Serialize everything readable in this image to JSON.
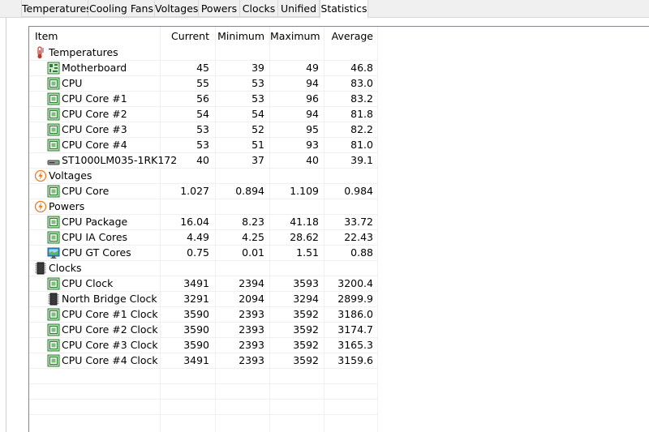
{
  "tabs": [
    {
      "label": "Temperatures",
      "active": false
    },
    {
      "label": "Cooling Fans",
      "active": false
    },
    {
      "label": "Voltages",
      "active": false
    },
    {
      "label": "Powers",
      "active": false
    },
    {
      "label": "Clocks",
      "active": false
    },
    {
      "label": "Unified",
      "active": false
    },
    {
      "label": "Statistics",
      "active": true
    }
  ],
  "columns": {
    "item": "Item",
    "current": "Current",
    "minimum": "Minimum",
    "maximum": "Maximum",
    "average": "Average"
  },
  "rows": [
    {
      "group": true,
      "icon": "thermometer-icon",
      "label": "Temperatures"
    },
    {
      "icon": "motherboard-icon",
      "label": "Motherboard",
      "current": "45",
      "minimum": "39",
      "maximum": "49",
      "average": "46.8"
    },
    {
      "icon": "cpu-chip-icon",
      "label": "CPU",
      "current": "55",
      "minimum": "53",
      "maximum": "94",
      "average": "83.0"
    },
    {
      "icon": "cpu-chip-icon",
      "label": "CPU Core #1",
      "current": "56",
      "minimum": "53",
      "maximum": "96",
      "average": "83.2"
    },
    {
      "icon": "cpu-chip-icon",
      "label": "CPU Core #2",
      "current": "54",
      "minimum": "54",
      "maximum": "94",
      "average": "81.8"
    },
    {
      "icon": "cpu-chip-icon",
      "label": "CPU Core #3",
      "current": "53",
      "minimum": "52",
      "maximum": "95",
      "average": "82.2"
    },
    {
      "icon": "cpu-chip-icon",
      "label": "CPU Core #4",
      "current": "53",
      "minimum": "51",
      "maximum": "93",
      "average": "81.0"
    },
    {
      "icon": "hard-drive-icon",
      "label": "ST1000LM035-1RK172",
      "current": "40",
      "minimum": "37",
      "maximum": "40",
      "average": "39.1"
    },
    {
      "group": true,
      "icon": "lightning-icon",
      "label": "Voltages"
    },
    {
      "icon": "cpu-chip-icon",
      "label": "CPU Core",
      "current": "1.027",
      "minimum": "0.894",
      "maximum": "1.109",
      "average": "0.984"
    },
    {
      "group": true,
      "icon": "lightning-icon",
      "label": "Powers"
    },
    {
      "icon": "cpu-chip-icon",
      "label": "CPU Package",
      "current": "16.04",
      "minimum": "8.23",
      "maximum": "41.18",
      "average": "33.72"
    },
    {
      "icon": "cpu-chip-icon",
      "label": "CPU IA Cores",
      "current": "4.49",
      "minimum": "4.25",
      "maximum": "28.62",
      "average": "22.43"
    },
    {
      "icon": "monitor-icon",
      "label": "CPU GT Cores",
      "current": "0.75",
      "minimum": "0.01",
      "maximum": "1.51",
      "average": "0.88"
    },
    {
      "group": true,
      "icon": "clock-module-icon",
      "label": "Clocks"
    },
    {
      "icon": "cpu-chip-icon",
      "label": "CPU Clock",
      "current": "3491",
      "minimum": "2394",
      "maximum": "3593",
      "average": "3200.4"
    },
    {
      "icon": "chipset-icon",
      "label": "North Bridge Clock",
      "current": "3291",
      "minimum": "2094",
      "maximum": "3294",
      "average": "2899.9"
    },
    {
      "icon": "cpu-chip-icon",
      "label": "CPU Core #1 Clock",
      "current": "3590",
      "minimum": "2393",
      "maximum": "3592",
      "average": "3186.0"
    },
    {
      "icon": "cpu-chip-icon",
      "label": "CPU Core #2 Clock",
      "current": "3590",
      "minimum": "2393",
      "maximum": "3592",
      "average": "3174.7"
    },
    {
      "icon": "cpu-chip-icon",
      "label": "CPU Core #3 Clock",
      "current": "3590",
      "minimum": "2393",
      "maximum": "3592",
      "average": "3165.3"
    },
    {
      "icon": "cpu-chip-icon",
      "label": "CPU Core #4 Clock",
      "current": "3491",
      "minimum": "2393",
      "maximum": "3592",
      "average": "3159.6"
    }
  ],
  "colors": {
    "thermometer": "#c0392b",
    "lightning": "#e67e22",
    "chip": "#2e7d32",
    "monitor": "#2a8fd4"
  }
}
